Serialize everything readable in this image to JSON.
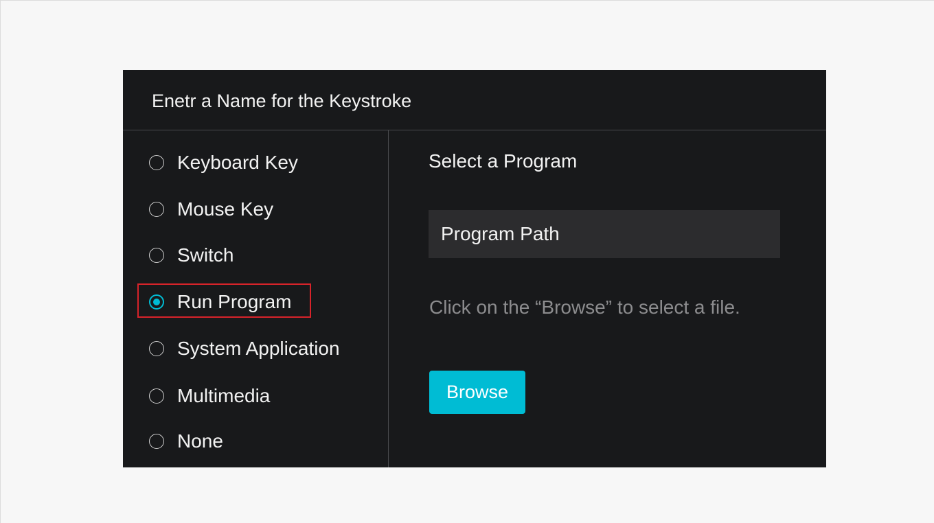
{
  "dialog": {
    "title": "Enetr a Name for the Keystroke"
  },
  "options": [
    {
      "label": "Keyboard Key",
      "selected": false
    },
    {
      "label": "Mouse Key",
      "selected": false
    },
    {
      "label": "Switch",
      "selected": false
    },
    {
      "label": "Run Program",
      "selected": true
    },
    {
      "label": "System Application",
      "selected": false
    },
    {
      "label": "Multimedia",
      "selected": false
    },
    {
      "label": "None",
      "selected": false
    }
  ],
  "program": {
    "section_title": "Select a Program",
    "path_placeholder": "Program Path",
    "path_value": "",
    "hint": "Click on the “Browse” to select a file.",
    "browse_label": "Browse"
  },
  "colors": {
    "accent": "#00bcd4",
    "highlight": "#d8232a",
    "dialog_background": "#18191b",
    "field_background": "#2c2c2e"
  }
}
